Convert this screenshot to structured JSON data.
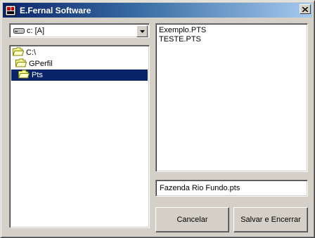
{
  "window": {
    "title": "E.Fernal Software"
  },
  "drive_select": {
    "value": "c: [A]",
    "icon": "hard-drive-icon"
  },
  "directories": [
    {
      "label": "C:\\",
      "icon": "open-folder-icon",
      "indent": 0,
      "selected": false
    },
    {
      "label": "GPerfil",
      "icon": "open-folder-icon",
      "indent": 1,
      "selected": false
    },
    {
      "label": "Pts",
      "icon": "open-folder-icon",
      "indent": 2,
      "selected": true
    }
  ],
  "files": [
    "Exemplo.PTS",
    "TESTE.PTS"
  ],
  "filename_input": {
    "value": "Fazenda Rio Fundo.pts"
  },
  "buttons": {
    "cancel": "Cancelar",
    "save": "Salvar e Encerrar"
  },
  "colors": {
    "titlebar_start": "#0a246a",
    "titlebar_end": "#a6caf0",
    "selection": "#0a246a",
    "face": "#d4d0c8"
  }
}
